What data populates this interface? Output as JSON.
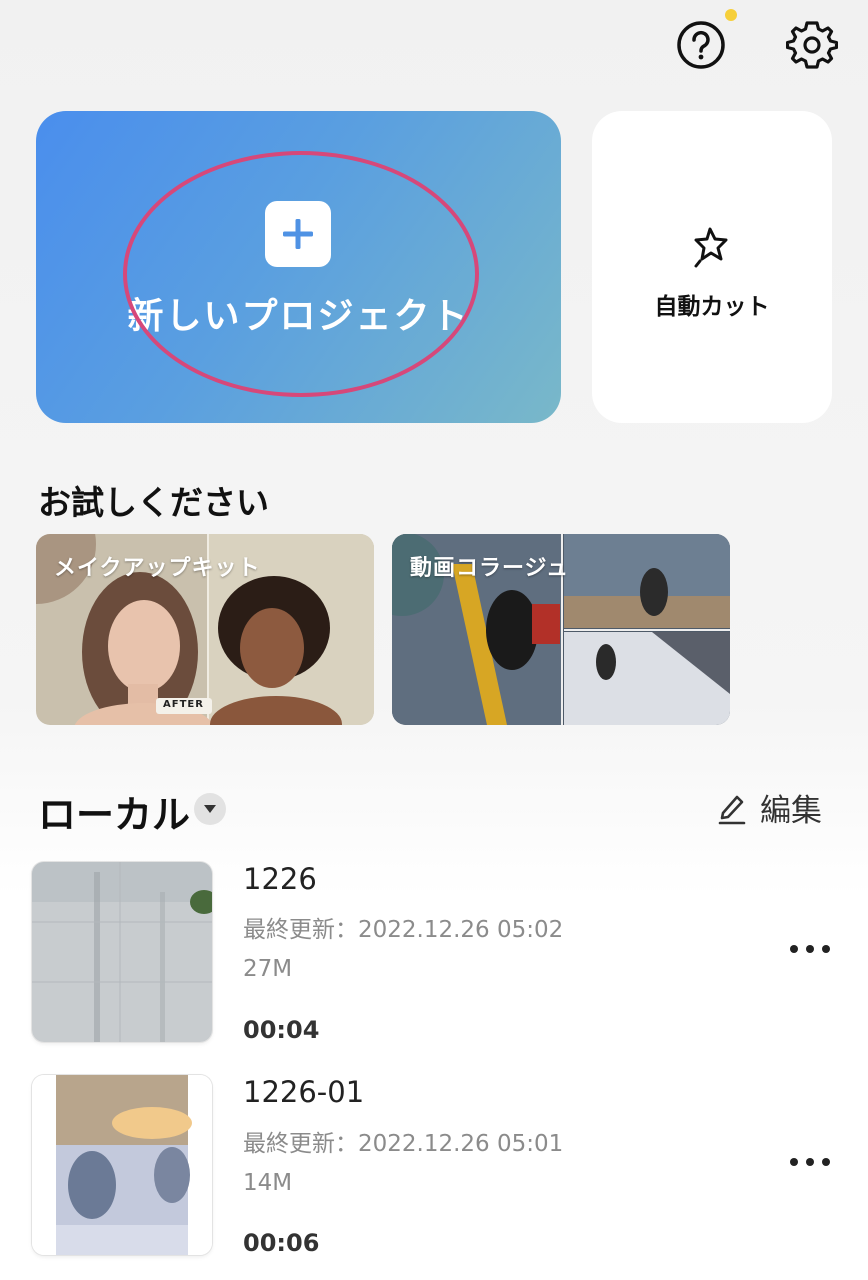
{
  "header": {
    "help_icon": "help-circle-icon",
    "settings_icon": "gear-icon",
    "help_badge_color": "#f6cf3a"
  },
  "new_project": {
    "label": "新しいプロジェクト",
    "icon": "plus-icon",
    "highlight_color": "#d6487a"
  },
  "auto_cut": {
    "label": "自動カット",
    "icon": "sparkle-star-icon"
  },
  "try_section": {
    "title": "お試しください",
    "cards": [
      {
        "label": "メイクアップキット",
        "badge": "AFTER"
      },
      {
        "label": "動画コラージュ"
      }
    ]
  },
  "local": {
    "title": "ローカル",
    "dropdown_icon": "caret-down-icon",
    "edit_label": "編集",
    "edit_icon": "pencil-icon",
    "projects": [
      {
        "name": "1226",
        "updated": "最終更新：2022.12.26 05:02",
        "size": "27M",
        "duration": "00:04"
      },
      {
        "name": "1226-01",
        "updated": "最終更新：2022.12.26 05:01",
        "size": "14M",
        "duration": "00:06"
      }
    ]
  }
}
